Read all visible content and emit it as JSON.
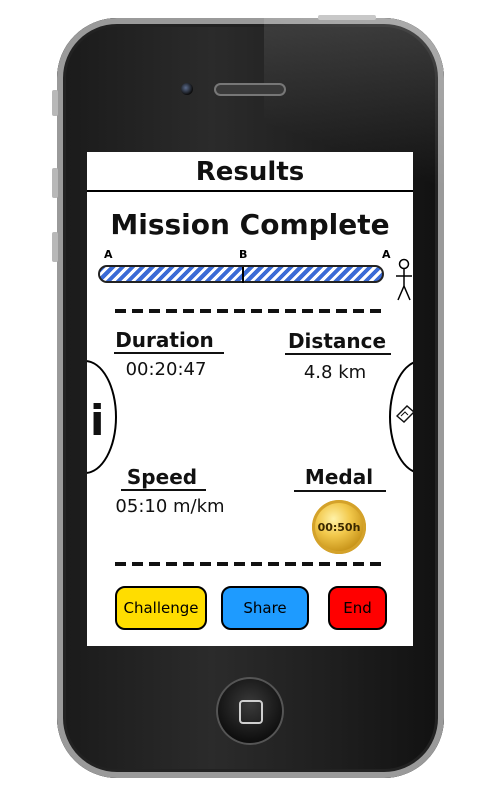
{
  "screen": {
    "title": "Results",
    "heading": "Mission Complete"
  },
  "route": {
    "start_label": "A",
    "mid_label": "B",
    "end_label": "A",
    "progress": 1.0,
    "fill_color": "#3b6bd6"
  },
  "stats": {
    "duration_label": "Duration",
    "duration_value": "00:20:47",
    "distance_label": "Distance",
    "distance_value": "4.8 km",
    "speed_label": "Speed",
    "speed_value": "05:10 m/km",
    "medal_label": "Medal",
    "medal_value": "00:50h"
  },
  "side_tabs": {
    "left_icon": "info-icon",
    "left_glyph": "i",
    "right_icon": "map-icon"
  },
  "buttons": {
    "challenge": {
      "label": "Challenge",
      "color": "#ffdd00"
    },
    "share": {
      "label": "Share",
      "color": "#1e9bff"
    },
    "end": {
      "label": "End",
      "color": "#ff0000"
    }
  }
}
